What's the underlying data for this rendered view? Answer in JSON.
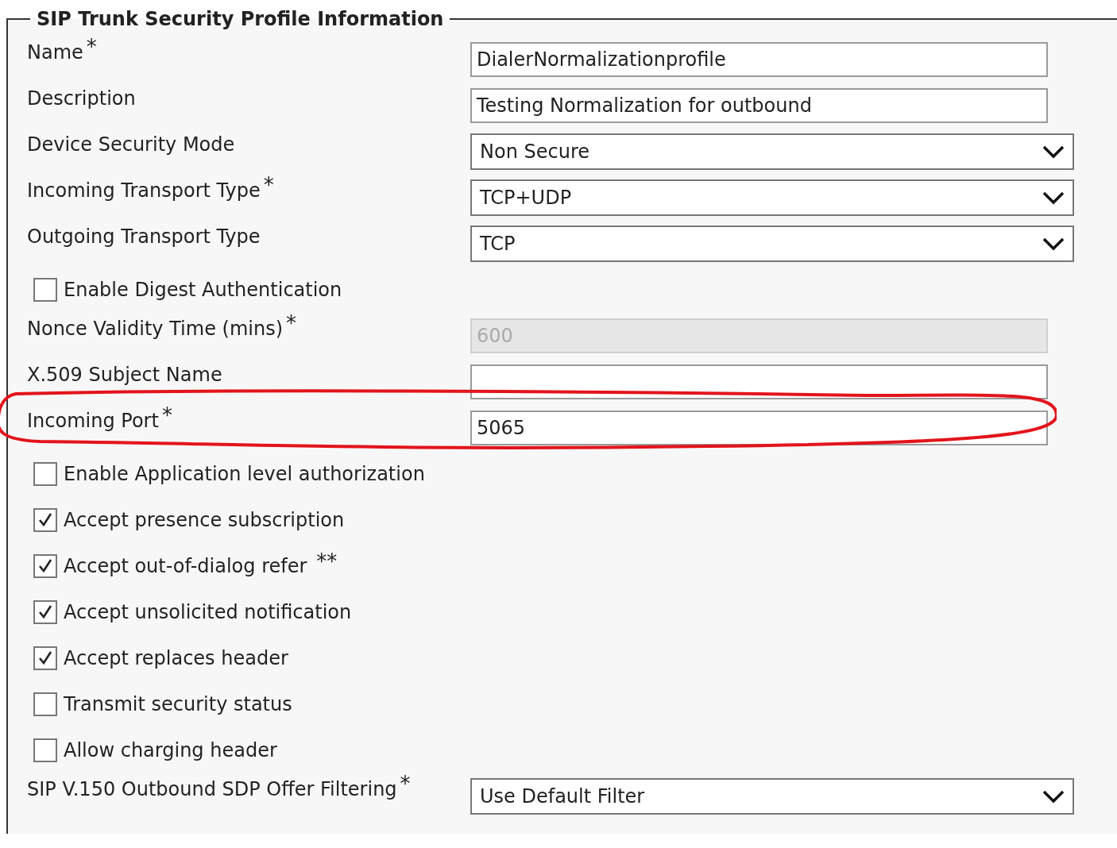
{
  "section": {
    "title": "SIP Trunk Security Profile Information",
    "rows": [
      {
        "kind": "text",
        "label": "Name",
        "required": "*",
        "value": "DialerNormalizationprofile",
        "disabled": false
      },
      {
        "kind": "text",
        "label": "Description",
        "value": "Testing Normalization for outbound",
        "disabled": false
      },
      {
        "kind": "select",
        "label": "Device Security Mode",
        "value": "Non Secure"
      },
      {
        "kind": "select",
        "label": "Incoming Transport Type",
        "required": "*",
        "value": "TCP+UDP"
      },
      {
        "kind": "select",
        "label": "Outgoing Transport Type",
        "value": "TCP"
      },
      {
        "kind": "checkbox",
        "label": "Enable Digest Authentication",
        "checked": false
      },
      {
        "kind": "text",
        "label": "Nonce Validity Time (mins)",
        "required": "*",
        "value": "600",
        "disabled": true
      },
      {
        "kind": "text",
        "label": "X.509 Subject Name",
        "disabled": false
      },
      {
        "kind": "text",
        "label": "Incoming Port",
        "required": "*",
        "value": "5065",
        "disabled": false,
        "highlighted": true
      },
      {
        "kind": "checkbox",
        "label": "Enable Application level authorization",
        "checked": false
      },
      {
        "kind": "checkbox",
        "label": "Accept presence subscription",
        "checked": true
      },
      {
        "kind": "checkbox",
        "label": "Accept out-of-dialog refer",
        "required": "**",
        "checked": true
      },
      {
        "kind": "checkbox",
        "label": "Accept unsolicited notification",
        "checked": true
      },
      {
        "kind": "checkbox",
        "label": "Accept replaces header",
        "checked": true
      },
      {
        "kind": "checkbox",
        "label": "Transmit security status",
        "checked": false
      },
      {
        "kind": "checkbox",
        "label": "Allow charging header",
        "checked": false
      },
      {
        "kind": "select",
        "label": "SIP V.150 Outbound SDP Offer Filtering",
        "required": "*",
        "value": "Use Default Filter"
      }
    ]
  }
}
